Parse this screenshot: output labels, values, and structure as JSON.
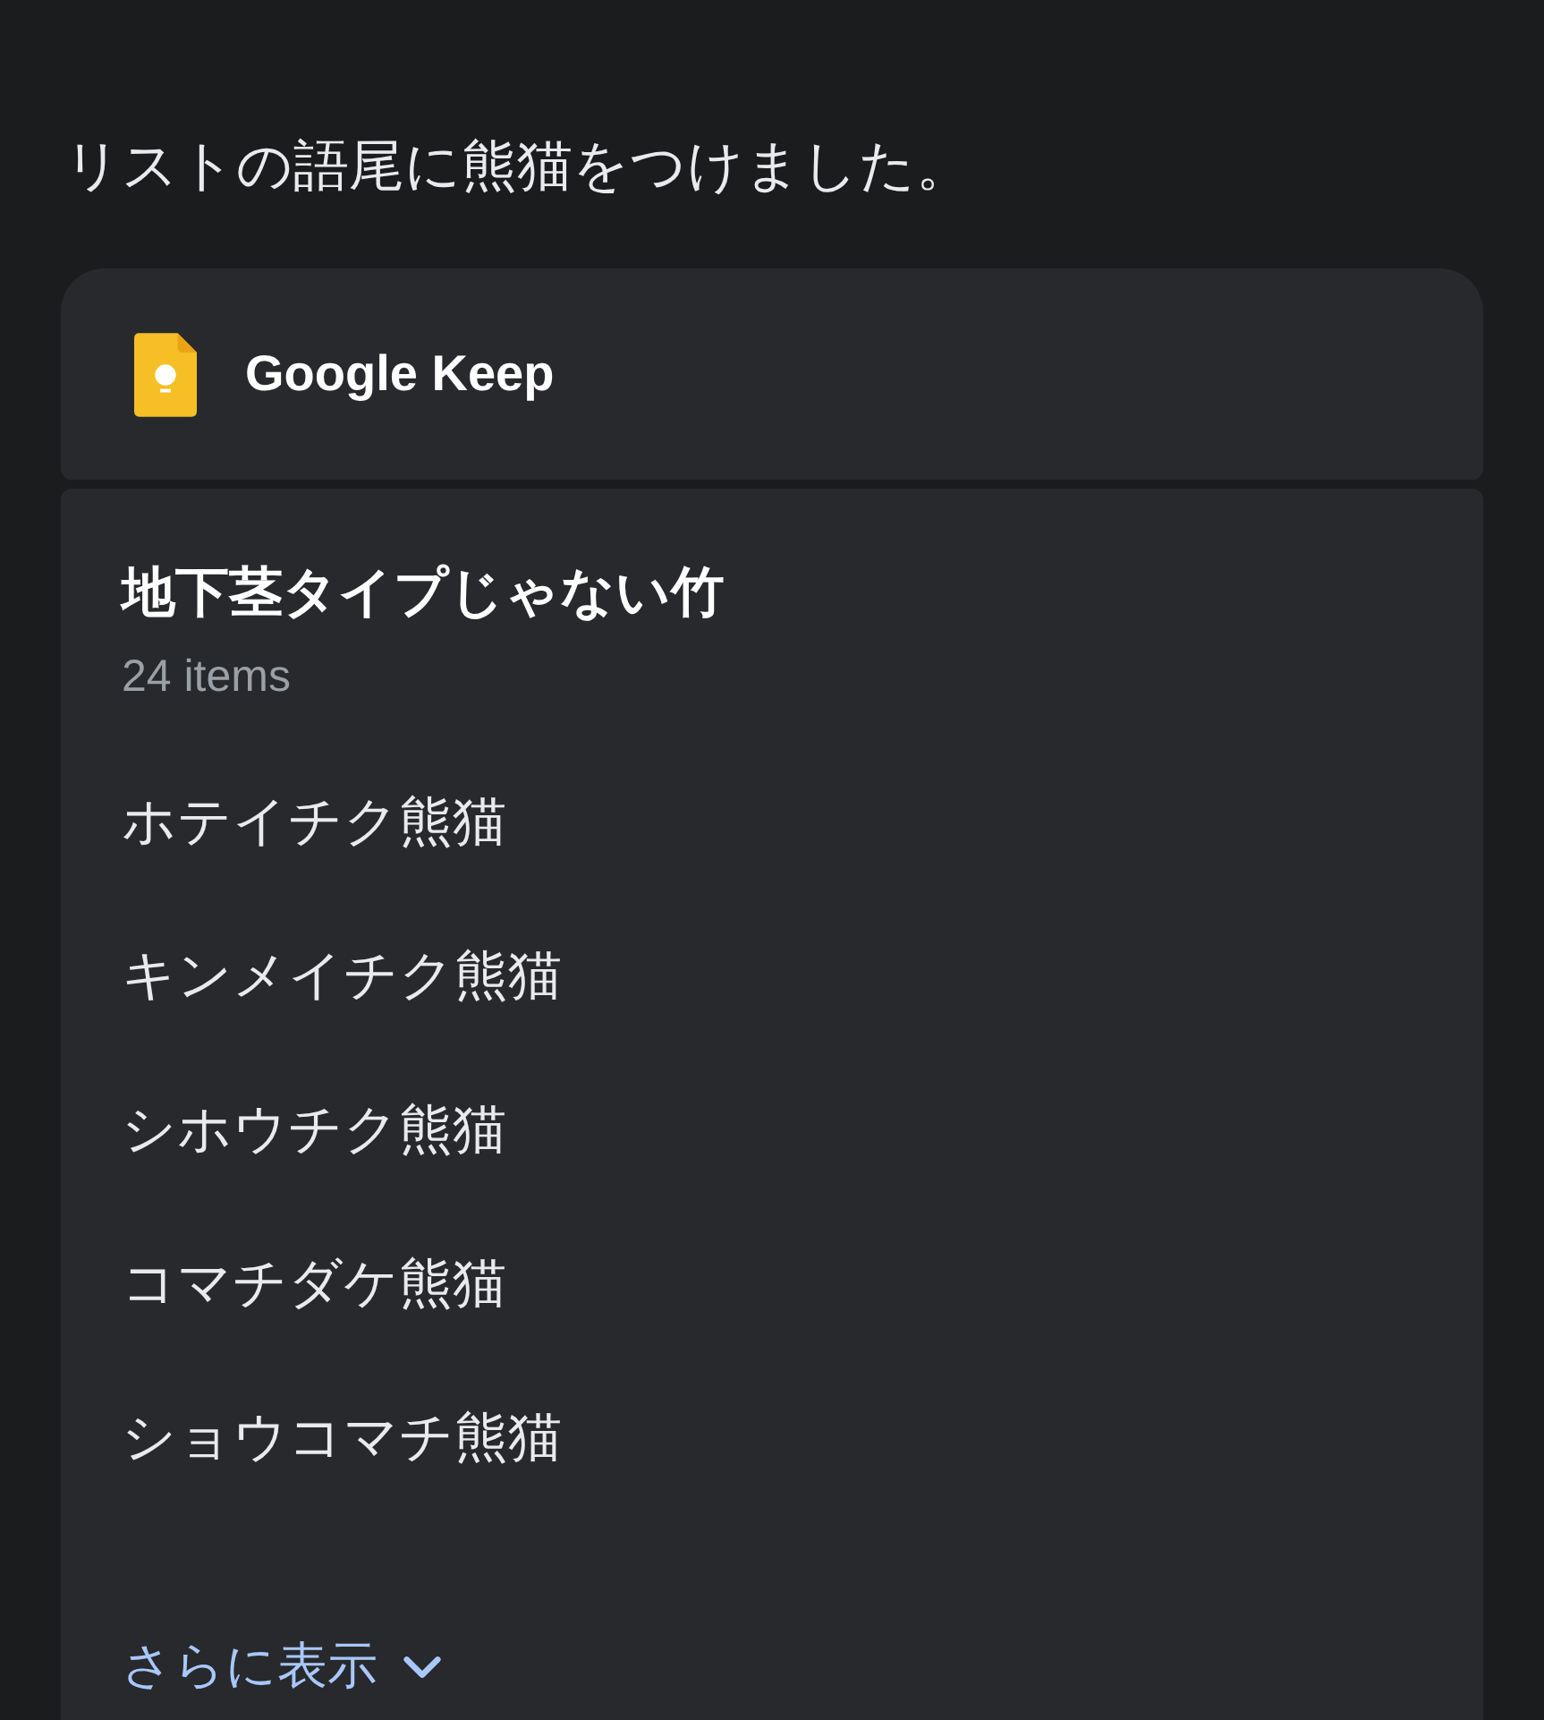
{
  "message": "リストの語尾に熊猫をつけました。",
  "app": {
    "name": "Google Keep"
  },
  "note": {
    "title": "地下茎タイプじゃない竹",
    "count": "24 items",
    "items": [
      "ホテイチク熊猫",
      "キンメイチク熊猫",
      "シホウチク熊猫",
      "コマチダケ熊猫",
      "ショウコマチ熊猫"
    ],
    "show_more": "さらに表示"
  }
}
